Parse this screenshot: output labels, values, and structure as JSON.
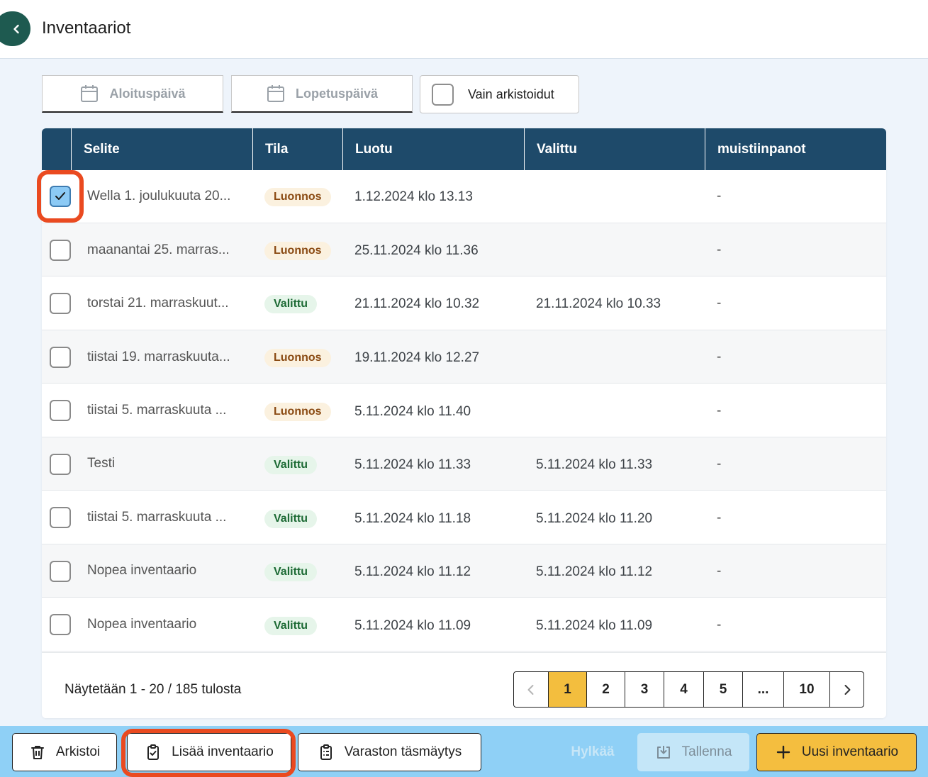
{
  "header": {
    "title": "Inventaariot"
  },
  "filters": {
    "start_date": "Aloituspäivä",
    "end_date": "Lopetuspäivä",
    "archived_only": "Vain arkistoidut"
  },
  "table": {
    "columns": [
      "Selite",
      "Tila",
      "Luotu",
      "Valittu",
      "muistiinpanot"
    ],
    "rows": [
      {
        "description": "Wella 1. joulukuuta 20...",
        "status": "Luonnos",
        "created": "1.12.2024 klo 13.13",
        "selected": "",
        "notes": "-",
        "checked": true
      },
      {
        "description": "maanantai 25. marras...",
        "status": "Luonnos",
        "created": "25.11.2024 klo 11.36",
        "selected": "",
        "notes": "-",
        "checked": false
      },
      {
        "description": "torstai 21. marraskuut...",
        "status": "Valittu",
        "created": "21.11.2024 klo 10.32",
        "selected": "21.11.2024 klo 10.33",
        "notes": "-",
        "checked": false
      },
      {
        "description": "tiistai 19. marraskuuta...",
        "status": "Luonnos",
        "created": "19.11.2024 klo 12.27",
        "selected": "",
        "notes": "-",
        "checked": false
      },
      {
        "description": "tiistai 5. marraskuuta ...",
        "status": "Luonnos",
        "created": "5.11.2024 klo 11.40",
        "selected": "",
        "notes": "-",
        "checked": false
      },
      {
        "description": "Testi",
        "status": "Valittu",
        "created": "5.11.2024 klo 11.33",
        "selected": "5.11.2024 klo 11.33",
        "notes": "-",
        "checked": false
      },
      {
        "description": "tiistai 5. marraskuuta ...",
        "status": "Valittu",
        "created": "5.11.2024 klo 11.18",
        "selected": "5.11.2024 klo 11.20",
        "notes": "-",
        "checked": false
      },
      {
        "description": "Nopea inventaario",
        "status": "Valittu",
        "created": "5.11.2024 klo 11.12",
        "selected": "5.11.2024 klo 11.12",
        "notes": "-",
        "checked": false
      },
      {
        "description": "Nopea inventaario",
        "status": "Valittu",
        "created": "5.11.2024 klo 11.09",
        "selected": "5.11.2024 klo 11.09",
        "notes": "-",
        "checked": false
      }
    ]
  },
  "pagination": {
    "prefix": "Näytetään",
    "range": "1 - 20",
    "separator": "/",
    "total": "185",
    "suffix": "tulosta",
    "pages": [
      "1",
      "2",
      "3",
      "4",
      "5",
      "...",
      "10"
    ],
    "active_page": "1"
  },
  "actions": {
    "archive": "Arkistoi",
    "add_inventory": "Lisää inventaario",
    "reconcile": "Varaston täsmäytys",
    "reject": "Hylkää",
    "save": "Tallenna",
    "new_inventory": "Uusi inventaario"
  },
  "colors": {
    "header_bg": "#1e4a6a",
    "accent_yellow": "#f3be3e",
    "bottom_bar": "#8fd0f6",
    "highlight": "#ea4a20"
  }
}
